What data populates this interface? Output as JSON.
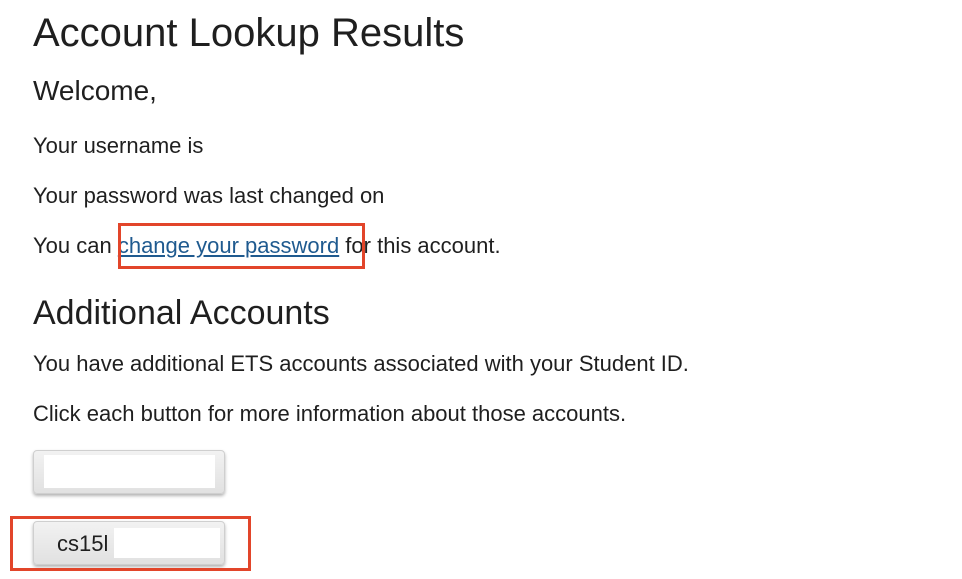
{
  "page": {
    "title": "Account Lookup Results",
    "welcome": "Welcome,",
    "username_text": "Your username is",
    "password_changed_text": "Your password was last changed on",
    "change_password": {
      "prefix": "You can ",
      "link_text": "change your password",
      "suffix": " for this account."
    }
  },
  "additional": {
    "title": "Additional Accounts",
    "description": "You have additional ETS accounts associated with your Student ID.",
    "instruction": "Click each button for more information about those accounts.",
    "buttons": [
      {
        "label": ""
      },
      {
        "label": "cs15l"
      }
    ]
  },
  "colors": {
    "link": "#1f5a8f",
    "highlight": "#e2452a"
  }
}
